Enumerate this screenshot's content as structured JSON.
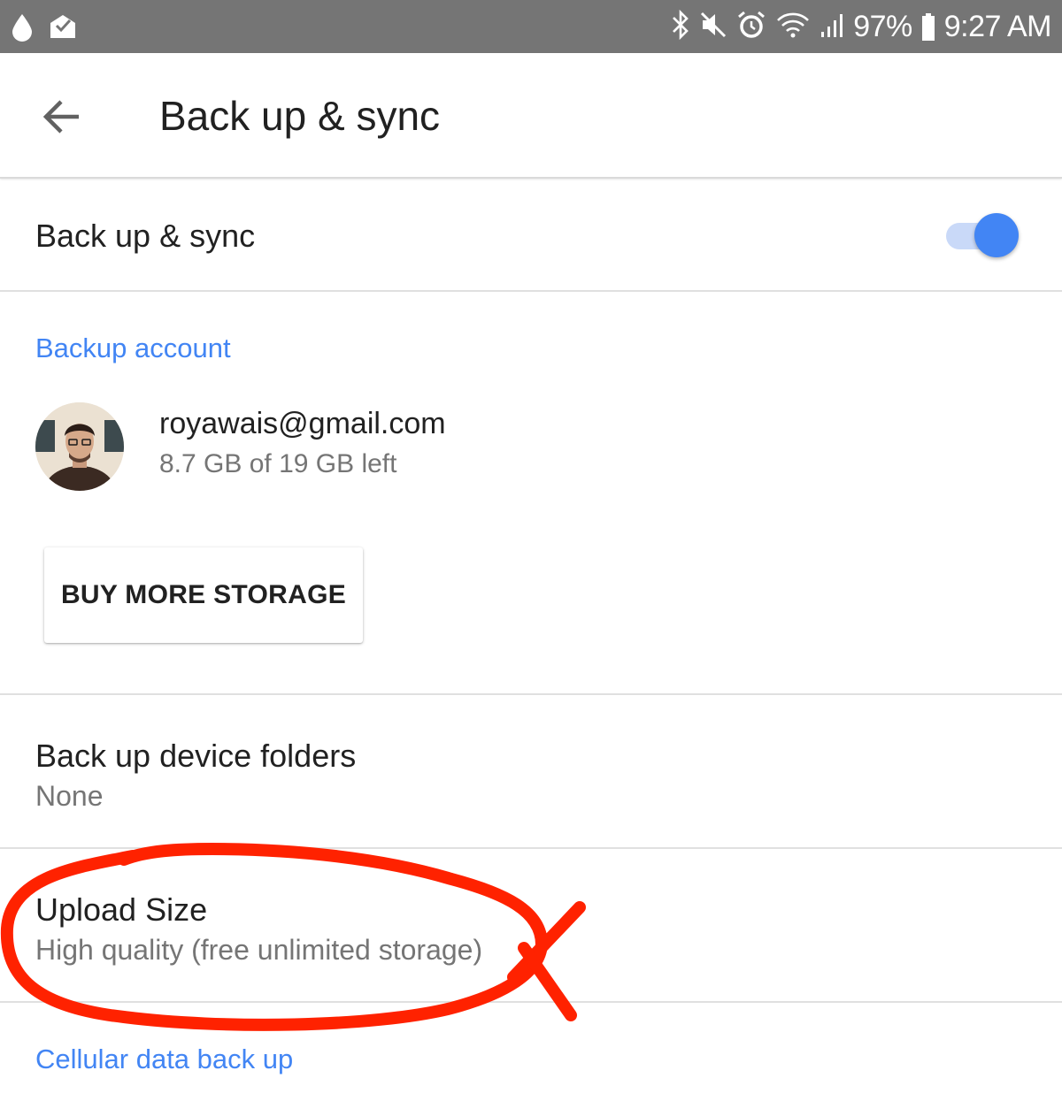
{
  "status_bar": {
    "battery_percent": "97%",
    "time": "9:27 AM",
    "icons_left": [
      "drop-icon",
      "mail-check-icon"
    ],
    "icons_right": [
      "bluetooth-icon",
      "mute-icon",
      "alarm-icon",
      "wifi-icon",
      "signal-icon",
      "battery-icon"
    ]
  },
  "app_bar": {
    "back_icon": "arrow-back-icon",
    "title": "Back up & sync"
  },
  "sync_row": {
    "label": "Back up & sync",
    "toggle_on": true
  },
  "backup_account": {
    "header": "Backup account",
    "email": "royawais@gmail.com",
    "storage_left": "8.7 GB of 19 GB left",
    "buy_button": "BUY MORE STORAGE"
  },
  "device_folders": {
    "title": "Back up device folders",
    "value": "None"
  },
  "upload_size": {
    "title": "Upload Size",
    "value": "High quality (free unlimited storage)"
  },
  "cellular": {
    "header": "Cellular data back up"
  },
  "colors": {
    "accent": "#4285f4",
    "status_bar": "#757575",
    "annotation": "#ff2200"
  }
}
